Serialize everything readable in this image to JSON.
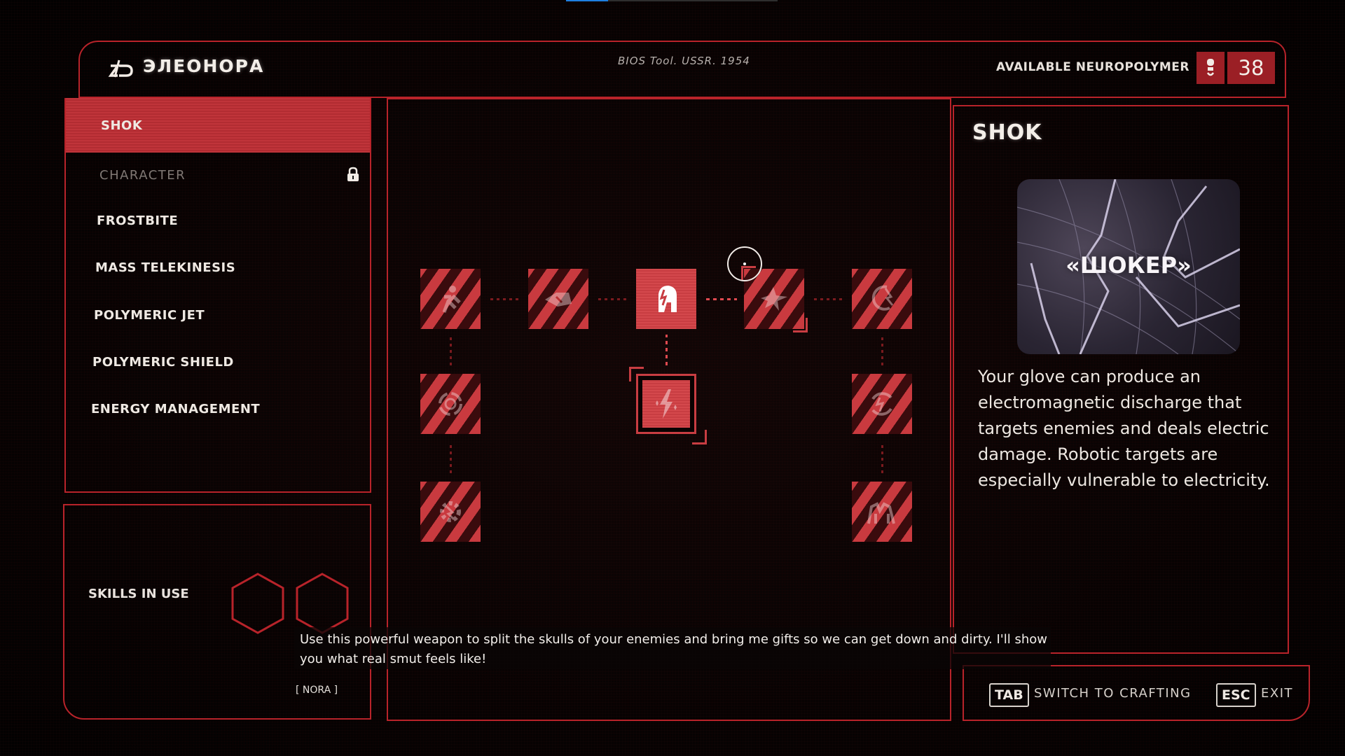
{
  "top_progress": {
    "fraction": 0.2,
    "fill_color": "#1e7fe0"
  },
  "header": {
    "logo_icon": "zd-logo-icon",
    "title": "ЭЛЕОНОРА",
    "subtitle": "BIOS Tool. USSR. 1954",
    "neuropolymer_label": "AVAILABLE NEUROPOLYMER",
    "neuropolymer_icon": "neuropolymer-icon",
    "neuropolymer_count": "38"
  },
  "sidebar": {
    "items": [
      {
        "label": "SHOK",
        "active": true,
        "locked": false
      },
      {
        "label": "CHARACTER",
        "active": false,
        "locked": true
      },
      {
        "label": "FROSTBITE",
        "active": false,
        "locked": false
      },
      {
        "label": "MASS TELEKINESIS",
        "active": false,
        "locked": false
      },
      {
        "label": "POLYMERIC JET",
        "active": false,
        "locked": false
      },
      {
        "label": "POLYMERIC SHIELD",
        "active": false,
        "locked": false
      },
      {
        "label": "ENERGY MANAGEMENT",
        "active": false,
        "locked": false
      }
    ]
  },
  "skills_in_use": {
    "label": "SKILLS IN USE",
    "slots": 2
  },
  "skill_tree": {
    "nodes": [
      {
        "id": "r1c1",
        "icon": "running-figure-icon",
        "state": "locked"
      },
      {
        "id": "r1c2",
        "icon": "glove-blast-icon",
        "state": "locked"
      },
      {
        "id": "r1c3",
        "icon": "shock-glove-icon",
        "state": "unlocked"
      },
      {
        "id": "r1c4",
        "icon": "electric-burst-icon",
        "state": "locked"
      },
      {
        "id": "r1c5",
        "icon": "chain-lightning-icon",
        "state": "locked"
      },
      {
        "id": "r2c1",
        "icon": "shock-ring-icon",
        "state": "locked"
      },
      {
        "id": "r2c3",
        "icon": "lightning-bolt-icon",
        "state": "selected"
      },
      {
        "id": "r2c5",
        "icon": "cycle-lightning-icon",
        "state": "locked"
      },
      {
        "id": "r3c1",
        "icon": "gear-spark-icon",
        "state": "locked"
      },
      {
        "id": "r3c5",
        "icon": "group-shock-icon",
        "state": "locked"
      }
    ]
  },
  "detail": {
    "title": "SHOK",
    "preview_title": "«ШОКЕР»",
    "description": "Your glove can produce an electromagnetic discharge that targets enemies and deals electric damage. Robotic targets are especially vulnerable to electricity."
  },
  "footer": {
    "tab_key": "TAB",
    "tab_label": "SWITCH TO CRAFTING",
    "esc_key": "ESC",
    "esc_label": "EXIT"
  },
  "dialogue": {
    "text": "Use this powerful weapon to split the skulls of your enemies and bring me gifts so we can get down and dirty. I'll show you what real smut feels like!",
    "speaker": "[ NORA ]"
  },
  "colors": {
    "accent": "#b8232a",
    "node": "#c93a3f",
    "text": "#ece6e2"
  }
}
